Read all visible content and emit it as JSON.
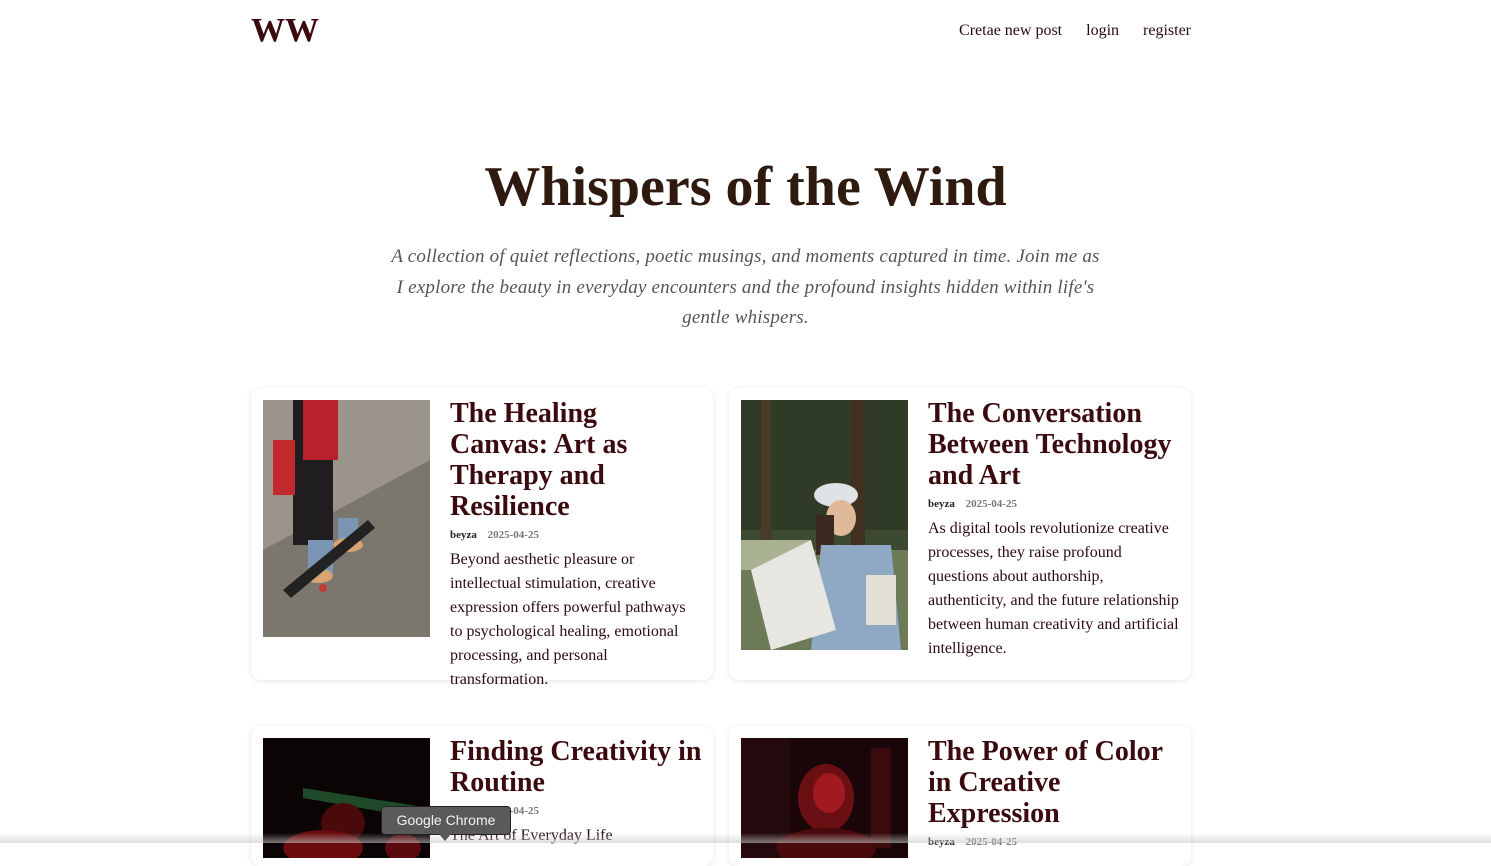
{
  "header": {
    "logo": "WW",
    "nav": [
      "Cretae new post",
      "login",
      "register"
    ]
  },
  "hero": {
    "title": "Whispers of the Wind",
    "subtitle": "A collection of quiet reflections, poetic musings, and moments captured in time. Join me as I explore the beauty in everyday encounters and the profound insights hidden within life's gentle whispers."
  },
  "posts": [
    {
      "title": "The Healing Canvas: Art as Therapy and Resilience",
      "author": "beyza",
      "date": "2025-04-25",
      "summary": "Beyond aesthetic pleasure or intellectual stimulation, creative expression offers powerful pathways to psychological healing, emotional processing, and personal transformation."
    },
    {
      "title": "The Conversation Between Technology and Art",
      "author": "beyza",
      "date": "2025-04-25",
      "summary": "As digital tools revolutionize creative processes, they raise profound questions about authorship, authenticity, and the future relationship between human creativity and artificial intelligence."
    },
    {
      "title": "Finding Creativity in Routine",
      "author": "beyza",
      "date": "2025-04-25",
      "summary": "The Art of Everyday Life"
    },
    {
      "title": "The Power of Color in Creative Expression",
      "author": "beyza",
      "date": "2025-04-25",
      "summary": ""
    }
  ],
  "tooltip": "Google Chrome",
  "colors": {
    "accent": "#3a0a0e",
    "hero_title": "#2e1a0e",
    "subtitle": "#555555"
  }
}
